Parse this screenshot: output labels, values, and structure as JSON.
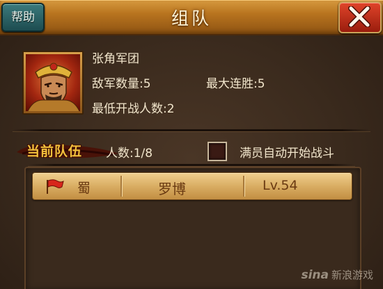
{
  "header": {
    "title": "组队",
    "help_label": "帮助",
    "close_icon": "close-x-icon",
    "colors": {
      "bar": "#b8741f",
      "close": "#d5361f",
      "help": "#2c6164"
    }
  },
  "commander": {
    "name": "张角军团",
    "enemy_count_label": "敌军数量:",
    "enemy_count_value": "5",
    "max_streak_label": "最大连胜:",
    "max_streak_value": "5",
    "min_players_label": "最低开战人数:",
    "min_players_value": "2",
    "portrait_icon": "general-portrait"
  },
  "team": {
    "banner": "当前队伍",
    "count_label": "人数:",
    "count_value": "1/8",
    "auto_start_label": "满员自动开始战斗",
    "auto_start_checked": false
  },
  "members": [
    {
      "faction": "蜀",
      "name": "罗博",
      "level": "Lv.54",
      "flag_icon": "red-flag-icon"
    }
  ],
  "watermark": {
    "brand": "sina",
    "text": "新浪游戏"
  }
}
